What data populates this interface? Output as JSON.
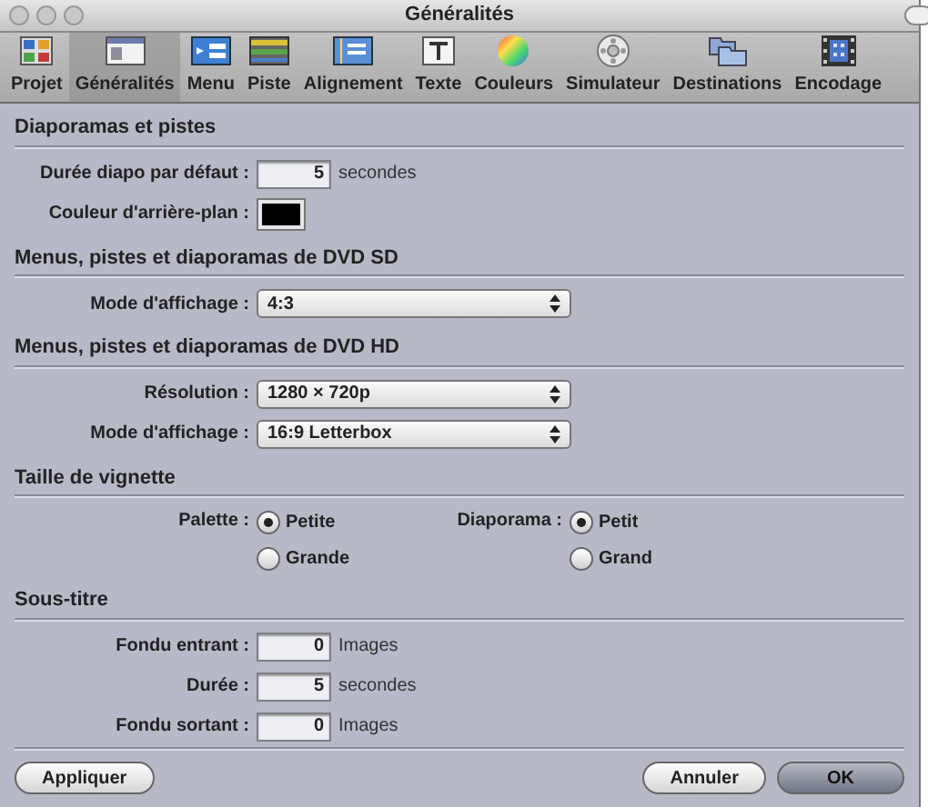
{
  "window": {
    "title": "Généralités"
  },
  "toolbar": {
    "items": [
      {
        "label": "Projet",
        "selected": false
      },
      {
        "label": "Généralités",
        "selected": true
      },
      {
        "label": "Menu",
        "selected": false
      },
      {
        "label": "Piste",
        "selected": false
      },
      {
        "label": "Alignement",
        "selected": false
      },
      {
        "label": "Texte",
        "selected": false
      },
      {
        "label": "Couleurs",
        "selected": false
      },
      {
        "label": "Simulateur",
        "selected": false
      },
      {
        "label": "Destinations",
        "selected": false
      },
      {
        "label": "Encodage",
        "selected": false
      }
    ]
  },
  "sections": [
    {
      "title": "Diaporamas et pistes",
      "rows": [
        {
          "kind": "number",
          "label": "Durée diapo par défaut :",
          "value": "5",
          "unit": "secondes"
        },
        {
          "kind": "color",
          "label": "Couleur d'arrière-plan :",
          "color": "#000000"
        }
      ]
    },
    {
      "title": "Menus, pistes et diaporamas de DVD SD",
      "rows": [
        {
          "kind": "select",
          "label": "Mode d'affichage :",
          "value": "4:3"
        }
      ]
    },
    {
      "title": "Menus, pistes et diaporamas de DVD HD",
      "rows": [
        {
          "kind": "select",
          "label": "Résolution :",
          "value": "1280 × 720p"
        },
        {
          "kind": "select",
          "label": "Mode d'affichage :",
          "value": "16:9 Letterbox"
        }
      ]
    },
    {
      "title": "Taille de vignette",
      "rows": [
        {
          "kind": "radios",
          "groups": [
            {
              "label": "Palette :",
              "options": [
                {
                  "label": "Petite",
                  "selected": true
                },
                {
                  "label": "Grande",
                  "selected": false
                }
              ]
            },
            {
              "label": "Diaporama :",
              "options": [
                {
                  "label": "Petit",
                  "selected": true
                },
                {
                  "label": "Grand",
                  "selected": false
                }
              ]
            }
          ]
        }
      ]
    },
    {
      "title": "Sous-titre",
      "rows": [
        {
          "kind": "number",
          "label": "Fondu entrant :",
          "value": "0",
          "unit": "Images"
        },
        {
          "kind": "number",
          "label": "Durée :",
          "value": "5",
          "unit": "secondes"
        },
        {
          "kind": "number",
          "label": "Fondu sortant :",
          "value": "0",
          "unit": "Images"
        }
      ]
    }
  ],
  "buttons": [
    {
      "label": "Appliquer",
      "default": false
    },
    {
      "label": "Annuler",
      "default": false
    },
    {
      "label": "OK",
      "default": true
    }
  ]
}
